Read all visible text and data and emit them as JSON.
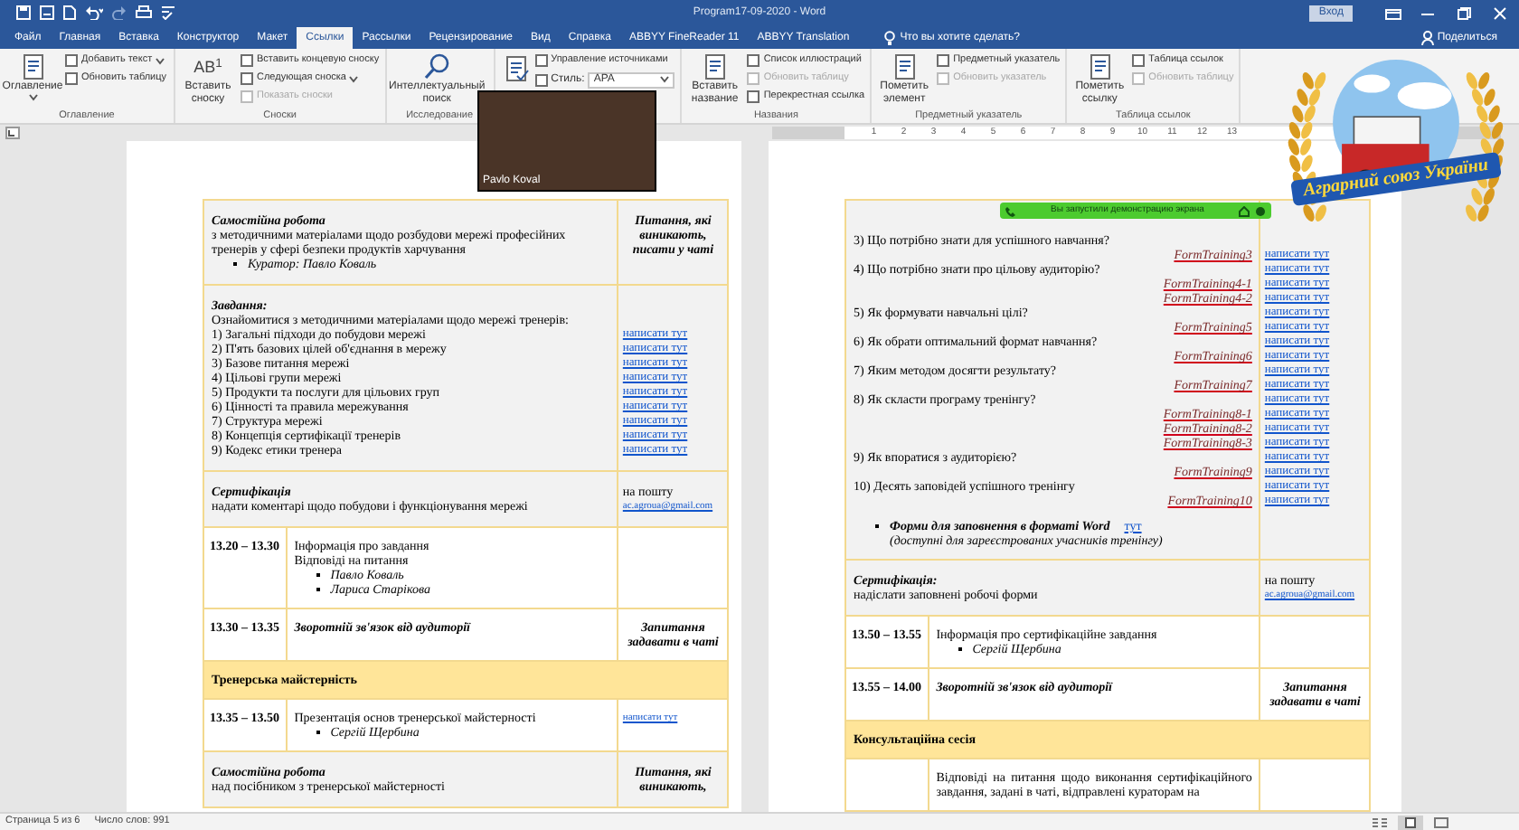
{
  "window": {
    "title": "Program17-09-2020 - Word",
    "sign_in": "Вход"
  },
  "tabs": [
    {
      "label": "Файл",
      "selected": false
    },
    {
      "label": "Главная",
      "selected": false
    },
    {
      "label": "Вставка",
      "selected": false
    },
    {
      "label": "Конструктор",
      "selected": false
    },
    {
      "label": "Макет",
      "selected": false
    },
    {
      "label": "Ссылки",
      "selected": true
    },
    {
      "label": "Рассылки",
      "selected": false
    },
    {
      "label": "Рецензирование",
      "selected": false
    },
    {
      "label": "Вид",
      "selected": false
    },
    {
      "label": "Справка",
      "selected": false
    },
    {
      "label": "ABBYY FineReader 11",
      "selected": false
    },
    {
      "label": "ABBYY Translation",
      "selected": false
    }
  ],
  "tell_me": "Что вы хотите сделать?",
  "share": "Поделиться",
  "ribbon_groups": [
    {
      "label": "Оглавление",
      "items": [
        {
          "kind": "large",
          "label": "Оглавление",
          "dropdown": true
        },
        {
          "kind": "small",
          "label": "Добавить текст",
          "dropdown": true,
          "disabled": false
        },
        {
          "kind": "small",
          "label": "Обновить таблицу",
          "disabled": false
        }
      ]
    },
    {
      "label": "Сноски",
      "items": [
        {
          "kind": "large",
          "label": "Вставить сноску",
          "glyph": "AB$^{1}$"
        },
        {
          "kind": "small",
          "label": "Вставить концевую сноску",
          "disabled": false
        },
        {
          "kind": "small",
          "label": "Следующая сноска",
          "dropdown": true,
          "disabled": false
        },
        {
          "kind": "small",
          "label": "Показать сноски",
          "disabled": true
        }
      ]
    },
    {
      "label": "Исследование",
      "items": [
        {
          "kind": "search",
          "label": "Интеллектуальный поиск"
        }
      ]
    },
    {
      "items": [
        {
          "kind": "large_icon"
        },
        {
          "kind": "small",
          "label": "Управление источниками",
          "disabled": false
        },
        {
          "kind": "style",
          "label": "Стиль:",
          "value": "APA"
        }
      ]
    },
    {
      "label": "Названия",
      "items": [
        {
          "kind": "large",
          "label": "Вставить название"
        },
        {
          "kind": "small",
          "label": "Список иллюстраций",
          "disabled": false
        },
        {
          "kind": "small",
          "label": "Обновить таблицу",
          "disabled": true
        },
        {
          "kind": "small",
          "label": "Перекрестная ссылка",
          "disabled": false
        }
      ]
    },
    {
      "label": "Предметный указатель",
      "items": [
        {
          "kind": "large",
          "label": "Пометить элемент"
        },
        {
          "kind": "small",
          "label": "Предметный указатель",
          "disabled": false
        },
        {
          "kind": "small",
          "label": "Обновить указатель",
          "disabled": true
        }
      ]
    },
    {
      "label": "Таблица ссылок",
      "items": [
        {
          "kind": "large",
          "label": "Пометить ссылку"
        },
        {
          "kind": "small",
          "label": "Таблица ссылок",
          "disabled": false
        },
        {
          "kind": "small",
          "label": "Обновить таблицу",
          "disabled": true
        }
      ]
    }
  ],
  "ruler": {
    "numbers": [
      "1",
      "2",
      "3",
      "4",
      "5",
      "6",
      "7",
      "8",
      "9",
      "10",
      "11",
      "12",
      "13"
    ]
  },
  "video": {
    "name": "Pavlo Koval"
  },
  "share_banner": {
    "text": "Вы запустили демонстрацию экрана"
  },
  "logo": {
    "text": "Аграрний союз України"
  },
  "pages": [
    {
      "rows": [
        {
          "kind": "block",
          "shaded": true,
          "main": [
            {
              "kind": "heading",
              "text": "Самостійна робота"
            },
            {
              "kind": "text",
              "text": "з методичними матеріалами щодо розбудови мережі професійних тренерів у сфері безпеки продуктів харчування"
            },
            {
              "kind": "bullet",
              "text": "Куратор: Павло Коваль"
            }
          ],
          "side": [
            {
              "kind": "note",
              "text": "Питання, які виникають, писати у чаті"
            }
          ]
        },
        {
          "kind": "tasks",
          "shaded": true,
          "heading": "Завдання:",
          "intro": "Ознайомитися з методичними матеріалами щодо мережі тренерів:",
          "items": [
            {
              "text": "1) Загальні підходи до побудови мережі",
              "link": "написати тут"
            },
            {
              "text": "2) П'ять базових цілей об'єднання в мережу",
              "link": "написати тут"
            },
            {
              "text": "3) Базове питання мережі",
              "link": "написати тут"
            },
            {
              "text": "4) Цільові групи мережі",
              "link": "написати тут"
            },
            {
              "text": "5) Продукти та послуги для цільових груп",
              "link": "написати тут"
            },
            {
              "text": "6) Цінності та правила мережування",
              "link": "написати тут"
            },
            {
              "text": "7) Структура мережі",
              "link": "написати тут"
            },
            {
              "text": "8) Концепція сертифікації тренерів",
              "link": "написати тут"
            },
            {
              "text": "9) Кодекс етики тренера",
              "link": "написати тут"
            }
          ]
        },
        {
          "kind": "block",
          "shaded": true,
          "main": [
            {
              "kind": "heading",
              "text": "Сертифікація"
            },
            {
              "kind": "text",
              "text": "надати коментарі щодо побудови і функціонування мережі"
            }
          ],
          "side": [
            {
              "kind": "text",
              "text": "на пошту"
            },
            {
              "kind": "link",
              "text": "ac.agroua@gmail.com"
            }
          ]
        },
        {
          "kind": "timed",
          "shaded": false,
          "time": "13.20 – 13.30",
          "main": [
            {
              "kind": "text",
              "text": "Інформація про завдання"
            },
            {
              "kind": "text",
              "text": "Відповіді на питання"
            },
            {
              "kind": "bullet",
              "text": "Павло Коваль"
            },
            {
              "kind": "bullet",
              "text": "Лариса Старікова"
            }
          ],
          "side": []
        },
        {
          "kind": "timed",
          "shaded": false,
          "time": "13.30 – 13.35",
          "main": [
            {
              "kind": "bold_italic",
              "text": "Зворотній зв'язок від аудиторії"
            }
          ],
          "side": [
            {
              "kind": "note",
              "text": "Запитання задавати в чаті"
            }
          ]
        },
        {
          "kind": "section",
          "title": "Тренерська майстерність"
        },
        {
          "kind": "timed",
          "shaded": false,
          "time": "13.35 – 13.50",
          "main": [
            {
              "kind": "text",
              "text": "Презентація основ тренерської майстерності"
            },
            {
              "kind": "bullet",
              "text": "Сергій Щербина"
            }
          ],
          "side": [
            {
              "kind": "link",
              "text": "написати тут"
            }
          ]
        },
        {
          "kind": "block",
          "shaded": true,
          "main": [
            {
              "kind": "heading",
              "text": "Самостійна робота"
            },
            {
              "kind": "text",
              "text": "над посібником з тренерської майстерності"
            }
          ],
          "side": [
            {
              "kind": "note",
              "text": "Питання, які виникають,"
            }
          ]
        }
      ]
    },
    {
      "rows": [
        {
          "kind": "questions",
          "shaded": true,
          "items": [
            {
              "question": "3) Що потрібно знати для успішного навчання?",
              "forms": [
                "FormTraining3"
              ]
            },
            {
              "question": "4) Що потрібно знати про цільову аудиторію?",
              "forms": [
                "FormTraining4-1",
                "FormTraining4-2"
              ]
            },
            {
              "question": "5) Як формувати навчальні цілі?",
              "forms": [
                "FormTraining5"
              ]
            },
            {
              "question": "6) Як обрати оптимальний формат навчання?",
              "forms": [
                "FormTraining6"
              ]
            },
            {
              "question": "7) Яким методом досягти результату?",
              "forms": [
                "FormTraining7"
              ]
            },
            {
              "question": "8) Як скласти програму тренінгу?",
              "forms": [
                "FormTraining8-1",
                "FormTraining8-2",
                "FormTraining8-3"
              ]
            },
            {
              "question": "9) Як впоратися з аудиторією?",
              "forms": [
                "FormTraining9"
              ]
            },
            {
              "question": "10) Десять заповідей успішного тренінгу",
              "forms": [
                "FormTraining10"
              ]
            }
          ],
          "links": [
            "написати тут",
            "написати тут",
            "написати тут",
            "написати тут",
            "написати тут",
            "написати тут",
            "написати тут",
            "написати тут",
            "написати тут",
            "написати тут",
            "написати тут",
            "написати тут",
            "написати тут",
            "написати тут",
            "написати тут",
            "написати тут",
            "написати тут",
            "написати тут"
          ],
          "footer": {
            "text": "Форми для заповнення в форматі Word",
            "link": "тут",
            "note": "(доступні для зареєстрованих учасників тренінгу)"
          }
        },
        {
          "kind": "block",
          "shaded": true,
          "main": [
            {
              "kind": "heading",
              "text": "Сертифікація:"
            },
            {
              "kind": "text",
              "text": "надіслати заповнені робочі форми"
            }
          ],
          "side": [
            {
              "kind": "text",
              "text": "на пошту"
            },
            {
              "kind": "link",
              "text": "ac.agroua@gmail.com"
            }
          ]
        },
        {
          "kind": "timed",
          "shaded": false,
          "time": "13.50 – 13.55",
          "main": [
            {
              "kind": "text",
              "text": "Інформація про сертифікаційне завдання"
            },
            {
              "kind": "bullet",
              "text": "Сергій Щербина"
            }
          ],
          "side": []
        },
        {
          "kind": "timed",
          "shaded": false,
          "time": "13.55 – 14.00",
          "main": [
            {
              "kind": "bold_italic",
              "text": "Зворотній зв'язок від аудиторії"
            }
          ],
          "side": [
            {
              "kind": "note",
              "text": "Запитання задавати в чаті"
            }
          ]
        },
        {
          "kind": "section",
          "title": "Консультаційна сесія"
        },
        {
          "kind": "timed",
          "shaded": false,
          "main": [
            {
              "kind": "para",
              "text": "Відповіді на питання щодо виконання сертифікаційного завдання, задані в чаті, відправлені кураторам на"
            }
          ],
          "side": []
        }
      ]
    }
  ],
  "status_bar": {
    "page": "Страница 5 из 6",
    "words": "Число слов: 991"
  }
}
